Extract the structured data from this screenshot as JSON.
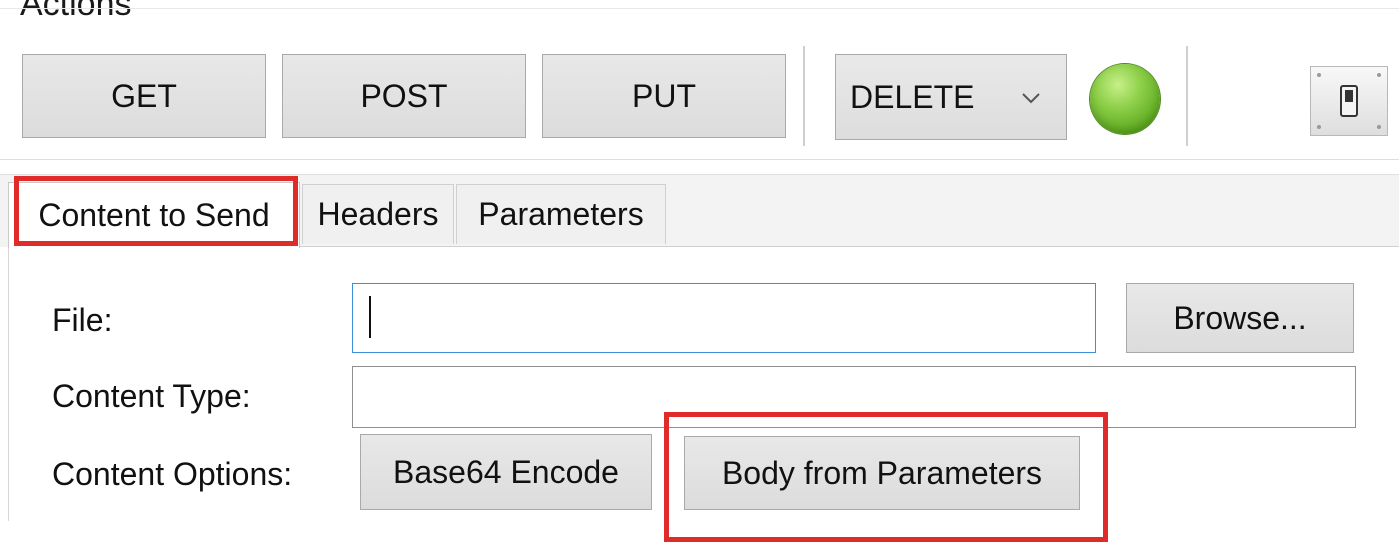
{
  "actions": {
    "title": "Actions",
    "get_label": "GET",
    "post_label": "POST",
    "put_label": "PUT",
    "method_select_value": "DELETE",
    "status_indicator_color": "#6fbf2a"
  },
  "tabs": [
    {
      "label": "Content to Send",
      "active": true
    },
    {
      "label": "Headers",
      "active": false
    },
    {
      "label": "Parameters",
      "active": false
    }
  ],
  "form": {
    "file_label": "File:",
    "file_value": "",
    "browse_label": "Browse...",
    "content_type_label": "Content Type:",
    "content_type_value": "",
    "content_options_label": "Content Options:",
    "base64_label": "Base64 Encode",
    "body_from_params_label": "Body from Parameters"
  },
  "highlight_color": "#e02b2b"
}
